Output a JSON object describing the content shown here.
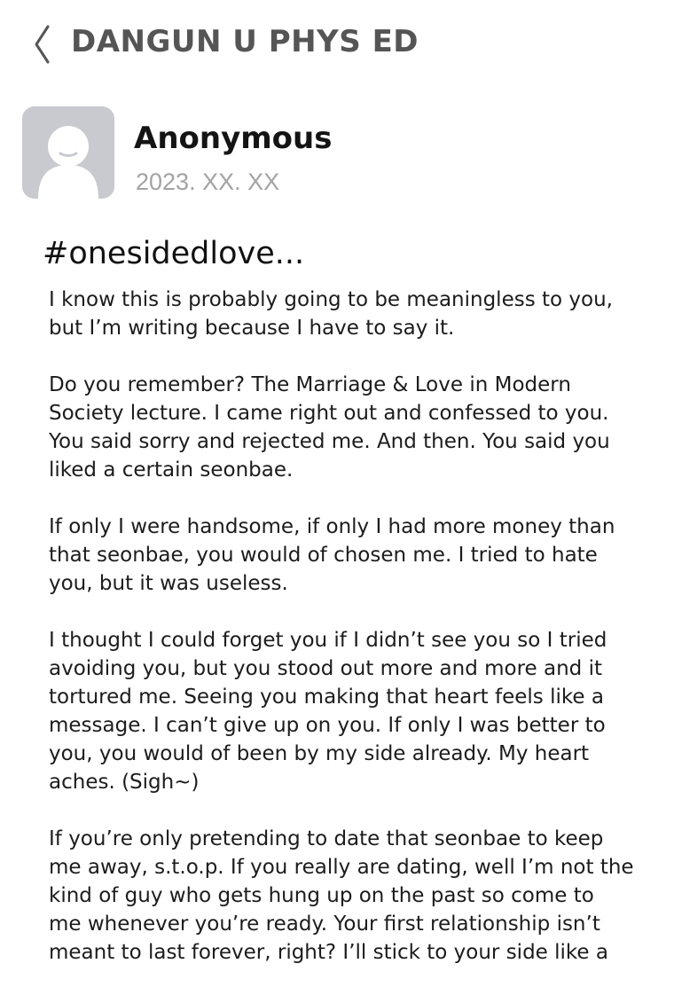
{
  "header": {
    "back_icon": "chevron-left-icon",
    "board_title": "DANGUN U PHYS ED"
  },
  "author": {
    "avatar_icon": "default-user-avatar-icon",
    "name": "Anonymous",
    "date": "2023. XX. XX"
  },
  "post": {
    "title": "#onesidedlove...",
    "paragraphs": [
      [
        "I know this is probably going to be meaningless to you,",
        "but I’m writing because I have to say it."
      ],
      [
        "Do you remember? The Marriage & Love in Modern",
        "Society lecture. I came right out and confessed to you.",
        "You said sorry and rejected me. And then. You said you",
        "liked a certain seonbae."
      ],
      [
        "If only I were handsome, if only I had more money than",
        "that seonbae, you would of chosen me. I tried to hate",
        "you, but it was useless."
      ],
      [
        "I thought I could forget you if I didn’t see you so I tried",
        "avoiding you, but you stood out more and more and it",
        "tortured me. Seeing you making that heart feels like a",
        "message. I can’t give up on you. If only I was better to",
        "you, you would of been by my side already. My heart",
        "aches. (Sigh~)"
      ],
      [
        "If you’re only pretending to date that seonbae to keep",
        "me away, s.t.o.p. If you really are dating, well I’m not the",
        "kind of guy who gets hung up on the past so come to",
        "me whenever you’re ready. Your first relationship isn’t",
        "meant to last forever, right? I’ll stick to your side like a"
      ]
    ]
  },
  "colors": {
    "background": "#ffffff",
    "header_text": "#555555",
    "date_text": "#a3a3a3",
    "avatar_bg": "#c8cad0"
  }
}
